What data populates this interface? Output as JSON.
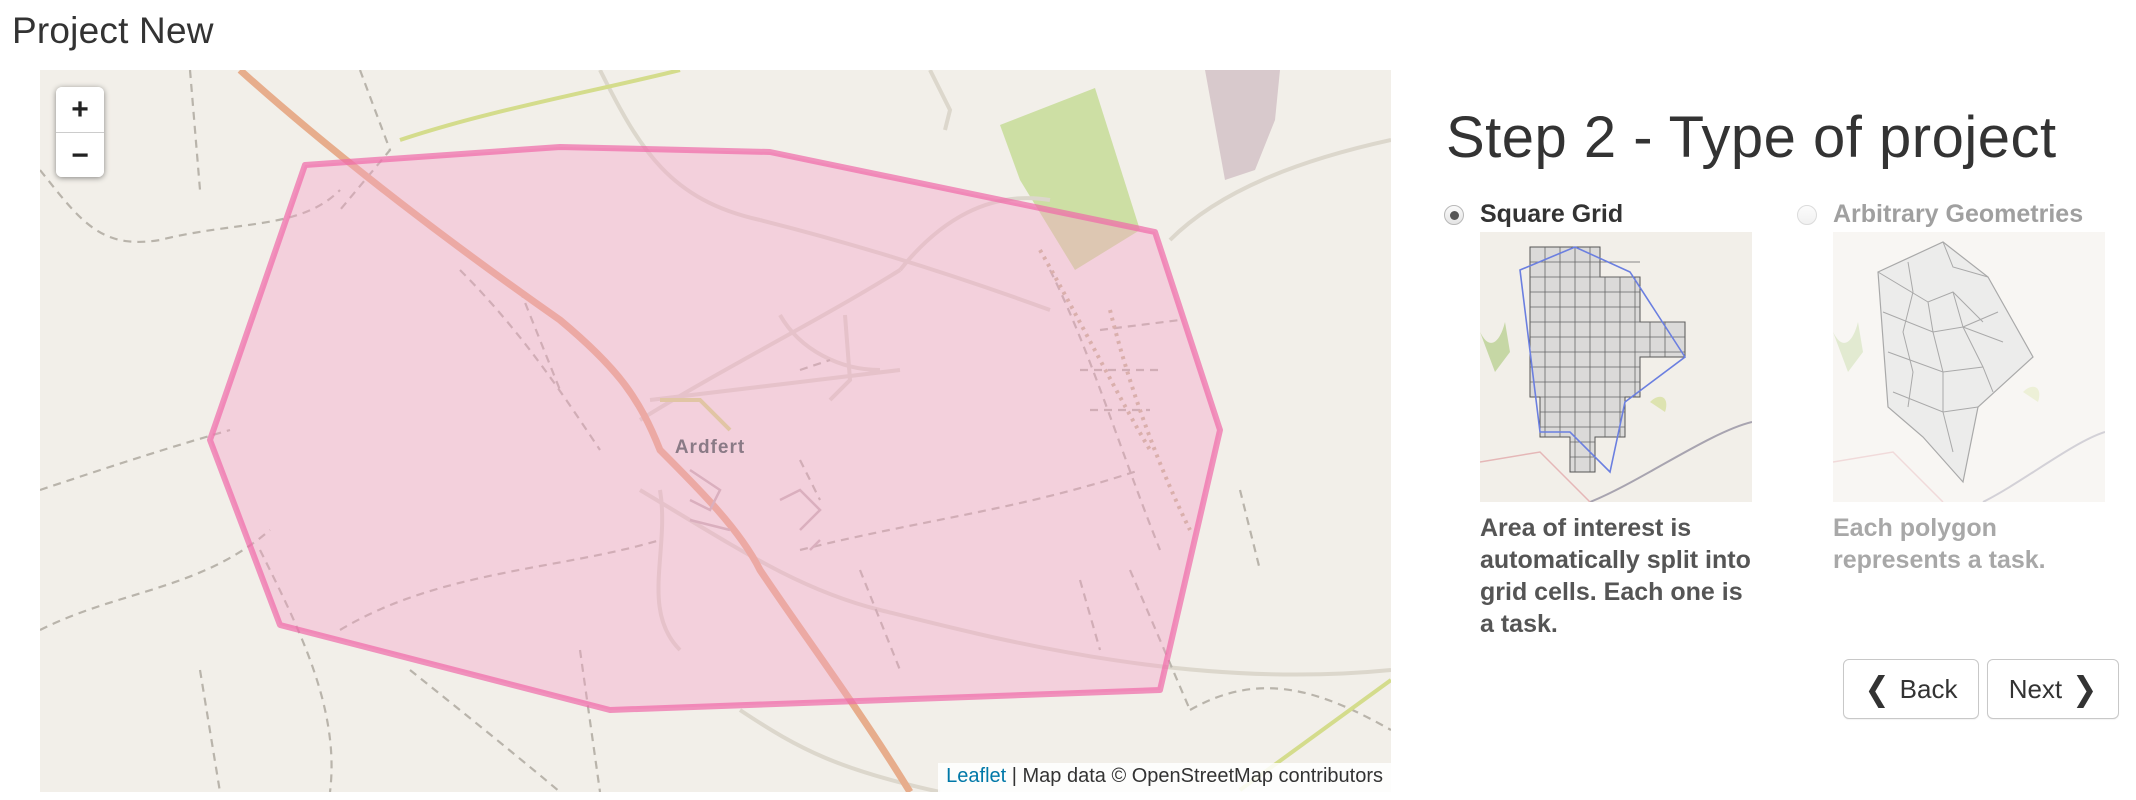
{
  "page": {
    "title": "Project New"
  },
  "map": {
    "zoom_in_label": "+",
    "zoom_out_label": "−",
    "place_label": "Ardfert",
    "attribution": {
      "link_text": "Leaflet",
      "text": " | Map data © OpenStreetMap contributors"
    },
    "colors": {
      "background": "#f2efe9",
      "area_fill": "#f5a3c7",
      "area_stroke": "#f06aa8",
      "major_road": "#e6a583",
      "minor_road": "#d8d3c8",
      "track": "#b8b3aa",
      "park": "#cddfa4"
    }
  },
  "step": {
    "title": "Step 2 - Type of project",
    "options": [
      {
        "label": "Square Grid",
        "selected": true,
        "enabled": true,
        "description": "Area of interest is automatically split into grid cells. Each one is a task.",
        "thumbnail_icon": "square-grid-preview"
      },
      {
        "label": "Arbitrary Geometries",
        "selected": false,
        "enabled": false,
        "description": "Each polygon represents a task.",
        "thumbnail_icon": "arbitrary-geometries-preview"
      }
    ]
  },
  "buttons": {
    "back_label": "Back",
    "next_label": "Next",
    "back_icon": "chevron-left-icon",
    "next_icon": "chevron-right-icon"
  }
}
